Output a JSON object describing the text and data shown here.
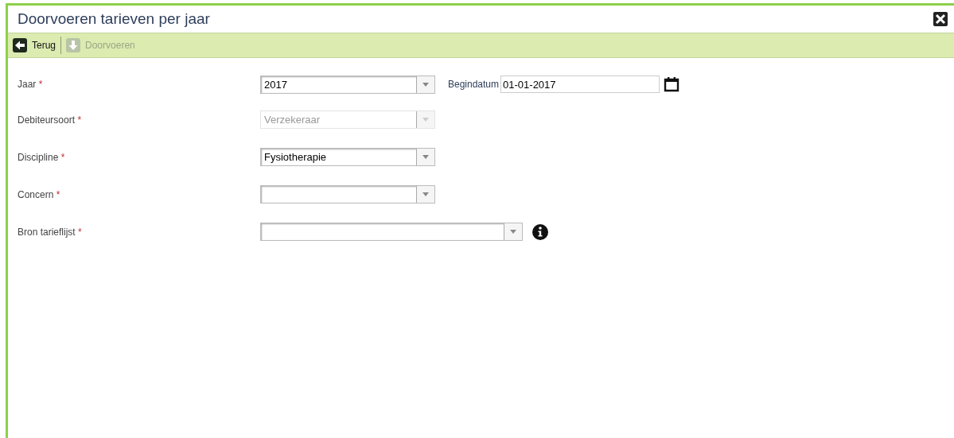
{
  "window": {
    "title": "Doorvoeren tarieven per jaar"
  },
  "toolbar": [
    {
      "label": "Terug",
      "disabled": false,
      "kind": "back"
    },
    {
      "label": "Doorvoeren",
      "disabled": true,
      "kind": "apply"
    }
  ],
  "fields": [
    {
      "label": "Jaar",
      "required_mark": "*",
      "value": "2017",
      "disabled": false,
      "wide": false,
      "info": false,
      "extra": {
        "label": "Begindatum",
        "value": "01-01-2017"
      }
    },
    {
      "label": "Debiteursoort",
      "required_mark": "*",
      "value": "Verzekeraar",
      "disabled": true,
      "wide": false,
      "info": false
    },
    {
      "label": "Discipline",
      "required_mark": "*",
      "value": "Fysiotherapie",
      "disabled": false,
      "wide": false,
      "info": false
    },
    {
      "label": "Concern",
      "required_mark": "*",
      "disabled": false,
      "wide": false,
      "info": false
    },
    {
      "label": "Bron tarieflijst",
      "required_mark": "*",
      "disabled": false,
      "wide": true,
      "info": true
    }
  ]
}
